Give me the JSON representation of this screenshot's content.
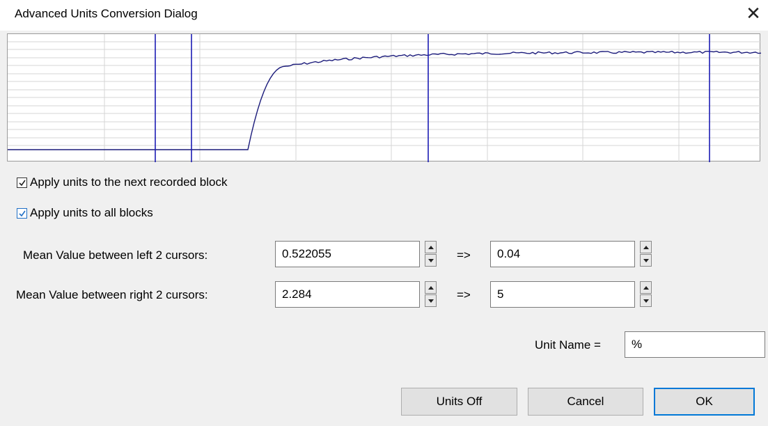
{
  "window": {
    "title": "Advanced Units Conversion Dialog",
    "close_glyph": "✕"
  },
  "graph": {
    "line_color": "#1a1a7a",
    "cursor_color": "#1c1cb4",
    "cursors": 4
  },
  "options": {
    "apply_next_block": {
      "label": "Apply units to the next recorded block",
      "checked": true
    },
    "apply_all_blocks": {
      "label": "Apply units to all blocks",
      "checked": true
    }
  },
  "conversion": {
    "left": {
      "label": "Mean Value between left 2 cursors:",
      "measured": "0.522055",
      "arrow": "=>",
      "target": "0.04"
    },
    "right": {
      "label": "Mean Value between right 2 cursors:",
      "measured": "2.284",
      "arrow": "=>",
      "target": "5"
    }
  },
  "unit": {
    "label": "Unit Name =",
    "value": "%"
  },
  "buttons": {
    "units_off": "Units Off",
    "cancel": "Cancel",
    "ok": "OK"
  },
  "colors": {
    "accent": "#0078d7",
    "dialog_bg": "#f0f0f0"
  }
}
